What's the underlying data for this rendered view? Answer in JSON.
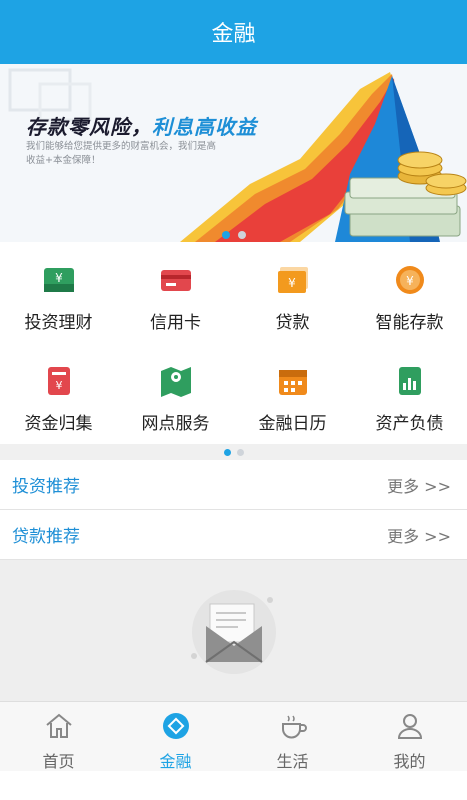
{
  "header": {
    "title": "金融"
  },
  "banner": {
    "title_part1": "存款零风险，",
    "title_part2": "利息高收益",
    "subtitle": "我们能够给您提供更多的财富机会，我们是高收益+本金保障！"
  },
  "grid": [
    {
      "label": "投资理财",
      "icon": "wallet-icon",
      "color": "#2f9e5f"
    },
    {
      "label": "信用卡",
      "icon": "credit-card-icon",
      "color": "#e2474d"
    },
    {
      "label": "贷款",
      "icon": "loan-icon",
      "color": "#f39a1e"
    },
    {
      "label": "智能存款",
      "icon": "coin-icon",
      "color": "#f08a1b"
    },
    {
      "label": "资金归集",
      "icon": "fund-collect-icon",
      "color": "#e2474d"
    },
    {
      "label": "网点服务",
      "icon": "map-location-icon",
      "color": "#2f9e5f"
    },
    {
      "label": "金融日历",
      "icon": "calendar-icon",
      "color": "#f08a1b"
    },
    {
      "label": "资产负债",
      "icon": "balance-sheet-icon",
      "color": "#2f9e5f"
    }
  ],
  "sections": {
    "invest": {
      "title": "投资推荐",
      "more": "更多 >>"
    },
    "loan": {
      "title": "贷款推荐",
      "more": "更多 >>"
    }
  },
  "tabs": [
    {
      "label": "首页",
      "icon": "home-icon",
      "active": false
    },
    {
      "label": "金融",
      "icon": "finance-icon",
      "active": true
    },
    {
      "label": "生活",
      "icon": "coffee-cup-icon",
      "active": false
    },
    {
      "label": "我的",
      "icon": "user-icon",
      "active": false
    }
  ],
  "colors": {
    "brand": "#1ea3e4",
    "link": "#1e8fd6"
  }
}
